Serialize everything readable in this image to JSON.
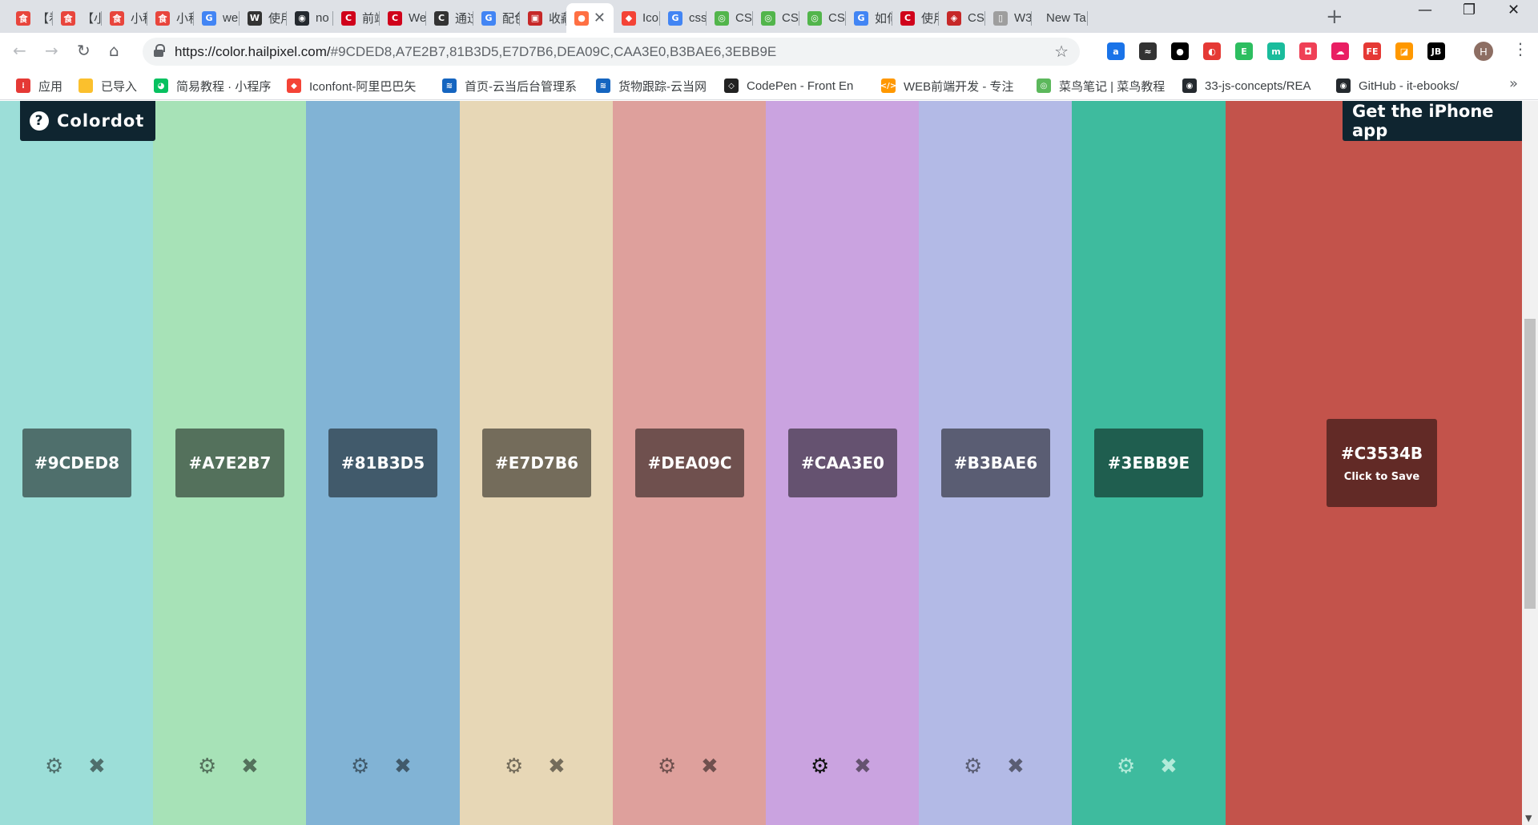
{
  "browser": {
    "tabs": [
      {
        "title": "【看",
        "favicon_color": "#e8453c",
        "favicon_glyph": "食"
      },
      {
        "title": "【小",
        "favicon_color": "#e8453c",
        "favicon_glyph": "食"
      },
      {
        "title": "小程",
        "favicon_color": "#e8453c",
        "favicon_glyph": "食"
      },
      {
        "title": "小程",
        "favicon_color": "#e8453c",
        "favicon_glyph": "食"
      },
      {
        "title": "we",
        "favicon_color": "#4285f4",
        "favicon_glyph": "G"
      },
      {
        "title": "使用",
        "favicon_color": "#333333",
        "favicon_glyph": "W"
      },
      {
        "title": "no",
        "favicon_color": "#24292e",
        "favicon_glyph": "◉"
      },
      {
        "title": "前端",
        "favicon_color": "#d0021b",
        "favicon_glyph": "C"
      },
      {
        "title": "We",
        "favicon_color": "#d0021b",
        "favicon_glyph": "C"
      },
      {
        "title": "通过",
        "favicon_color": "#333333",
        "favicon_glyph": "C"
      },
      {
        "title": "配色",
        "favicon_color": "#4285f4",
        "favicon_glyph": "G"
      },
      {
        "title": "收藏",
        "favicon_color": "#c62828",
        "favicon_glyph": "▣"
      },
      {
        "title": "",
        "favicon_color": "#ff7043",
        "favicon_glyph": "●",
        "active": true
      },
      {
        "title": "Ico",
        "favicon_color": "#f44336",
        "favicon_glyph": "◆"
      },
      {
        "title": "css",
        "favicon_color": "#4285f4",
        "favicon_glyph": "G"
      },
      {
        "title": "CS",
        "favicon_color": "#52b54b",
        "favicon_glyph": "◎"
      },
      {
        "title": "CS",
        "favicon_color": "#52b54b",
        "favicon_glyph": "◎"
      },
      {
        "title": "CS",
        "favicon_color": "#52b54b",
        "favicon_glyph": "◎"
      },
      {
        "title": "如何",
        "favicon_color": "#4285f4",
        "favicon_glyph": "G"
      },
      {
        "title": "使用",
        "favicon_color": "#d0021b",
        "favicon_glyph": "C"
      },
      {
        "title": "CS",
        "favicon_color": "#c62828",
        "favicon_glyph": "◈"
      },
      {
        "title": "W3",
        "favicon_color": "#9e9e9e",
        "favicon_glyph": "▯"
      },
      {
        "title": "New Ta",
        "favicon_color": "",
        "favicon_glyph": ""
      }
    ],
    "new_tab_icon": "plus-icon",
    "window_controls": [
      "minimize-icon",
      "restore-icon",
      "close-icon"
    ],
    "url_host": "https://color.hailpixel.com/",
    "url_rest": "#9CDED8,A7E2B7,81B3D5,E7D7B6,DEA09C,CAA3E0,B3BAE6,3EBB9E",
    "extensions": [
      {
        "name": "translate-extension-icon",
        "color": "#1a73e8",
        "glyph": "a"
      },
      {
        "name": "encoding-extension-icon",
        "color": "#333333",
        "glyph": "≈"
      },
      {
        "name": "tampermonkey-extension-icon",
        "color": "#000000",
        "glyph": "●"
      },
      {
        "name": "adblock-extension-icon",
        "color": "#e53935",
        "glyph": "◐"
      },
      {
        "name": "evernote-extension-icon",
        "color": "#2dbe60",
        "glyph": "E"
      },
      {
        "name": "mint-extension-icon",
        "color": "#1abc9c",
        "glyph": "m"
      },
      {
        "name": "pocket-extension-icon",
        "color": "#ef4056",
        "glyph": "◘"
      },
      {
        "name": "cloud-extension-icon",
        "color": "#e91e63",
        "glyph": "☁"
      },
      {
        "name": "fe-helper-extension-icon",
        "color": "#e53935",
        "glyph": "FE"
      },
      {
        "name": "colorzilla-extension-icon",
        "color": "#ff9800",
        "glyph": "◪"
      },
      {
        "name": "jetbrains-extension-icon",
        "color": "#000000",
        "glyph": "JB"
      }
    ],
    "profile_initial": "H",
    "bookmarks": [
      {
        "label": "应用",
        "color": "#e53935",
        "glyph": "⁞"
      },
      {
        "label": "已导入",
        "color": "#fbc02d",
        "glyph": ""
      },
      {
        "label": "简易教程 · 小程序",
        "color": "#07c160",
        "glyph": "◕"
      },
      {
        "label": "Iconfont-阿里巴巴矢",
        "color": "#f44336",
        "glyph": "◆"
      },
      {
        "label": "首页-云当后台管理系",
        "color": "#1565c0",
        "glyph": "≋"
      },
      {
        "label": "货物跟踪-云当网",
        "color": "#1565c0",
        "glyph": "≋"
      },
      {
        "label": "CodePen - Front En",
        "color": "#222222",
        "glyph": "◇"
      },
      {
        "label": "WEB前端开发 - 专注",
        "color": "#ff9800",
        "glyph": "</>"
      },
      {
        "label": "菜鸟笔记 | 菜鸟教程",
        "color": "#5cb85c",
        "glyph": "◎"
      },
      {
        "label": "33-js-concepts/REA",
        "color": "#24292e",
        "glyph": "◉"
      },
      {
        "label": "GitHub - it-ebooks/",
        "color": "#24292e",
        "glyph": "◉"
      }
    ]
  },
  "app": {
    "brand_label": "Colordot",
    "brand_icon": "question-circle-icon",
    "iphone_label": "Get the iPhone app",
    "colors": [
      {
        "hex": "#9CDED8",
        "bg": "#9cded8",
        "label_bg": "#4f6f6c",
        "ctrl": "#4f6f6c"
      },
      {
        "hex": "#A7E2B7",
        "bg": "#a7e2b7",
        "label_bg": "#54715c",
        "ctrl": "#54715c"
      },
      {
        "hex": "#81B3D5",
        "bg": "#81b3d5",
        "label_bg": "#415a6b",
        "ctrl": "#415a6b"
      },
      {
        "hex": "#E7D7B6",
        "bg": "#e7d7b6",
        "label_bg": "#746c5b",
        "ctrl": "#746c5b"
      },
      {
        "hex": "#DEA09C",
        "bg": "#dea09c",
        "label_bg": "#6f504e",
        "ctrl": "#6f504e"
      },
      {
        "hex": "#CAA3E0",
        "bg": "#caa3e0",
        "label_bg": "#655270",
        "ctrl": "#655270",
        "gear_ctrl": "#111111"
      },
      {
        "hex": "#B3BAE6",
        "bg": "#b3bae6",
        "label_bg": "#5a5d73",
        "ctrl": "#5a5d73"
      },
      {
        "hex": "#3EBB9E",
        "bg": "#3ebb9e",
        "label_bg": "#1f5e4f",
        "ctrl": "#b2ebd9"
      }
    ],
    "preview": {
      "hex": "#C3534B",
      "bg": "#c3534b",
      "label_bg": "#622a26",
      "hint": "Click to Save"
    }
  }
}
